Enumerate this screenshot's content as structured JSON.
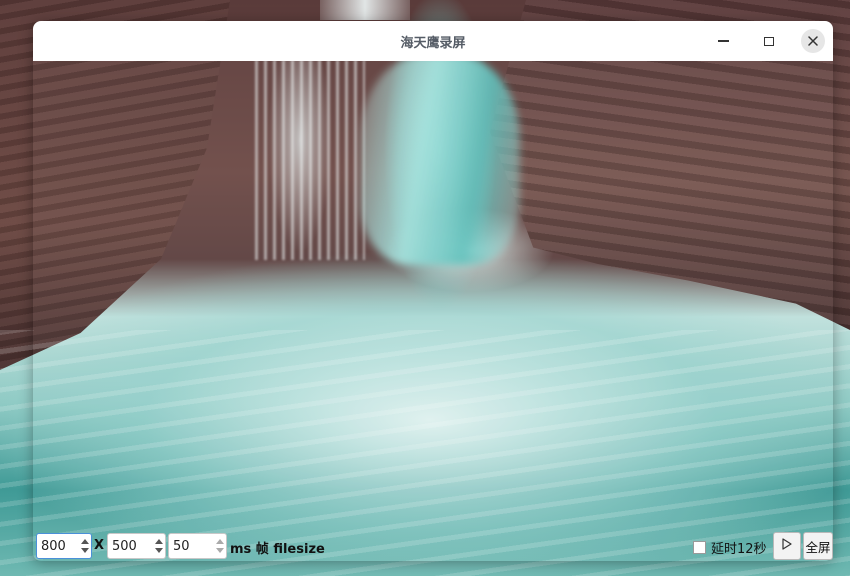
{
  "window": {
    "title": "海天鹰录屏"
  },
  "controls": {
    "width_value": "800",
    "x_separator": "X",
    "height_value": "500",
    "interval_value": "50",
    "interval_suffix": "ms 帧 filesize",
    "delay_label": "延时12秒",
    "delay_checked": false,
    "fullscreen_label": "全屏",
    "play_icon": "play-triangle-icon"
  }
}
